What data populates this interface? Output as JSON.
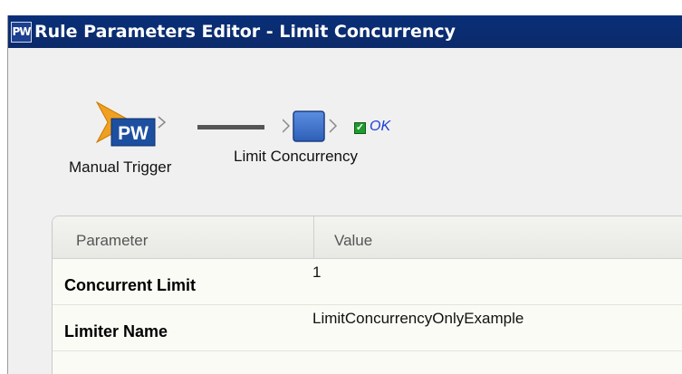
{
  "window": {
    "icon_text": "PW",
    "title": "Rule Parameters Editor - Limit Concurrency"
  },
  "flow": {
    "trigger": {
      "icon_text": "PW",
      "label": "Manual Trigger"
    },
    "step": {
      "label": "Limit Concurrency"
    },
    "status": {
      "text": "OK",
      "color": "#1a3fd6"
    }
  },
  "table": {
    "headers": [
      "Parameter",
      "Value"
    ],
    "rows": [
      {
        "name": "Concurrent Limit",
        "value": "1"
      },
      {
        "name": "Limiter Name",
        "value": "LimitConcurrencyOnlyExample"
      }
    ]
  },
  "colors": {
    "titlebar": "#0a2f78",
    "check": "#1e9a2e"
  }
}
